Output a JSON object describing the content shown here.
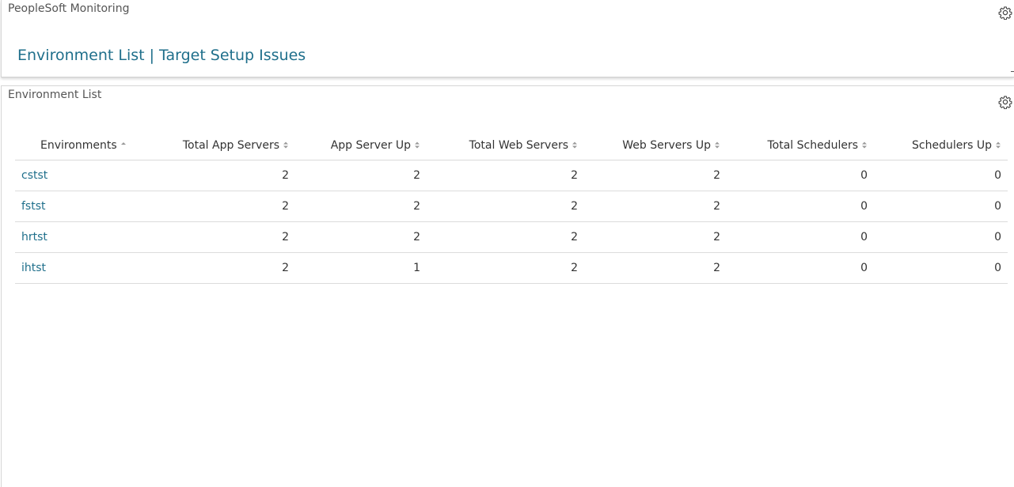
{
  "top_panel": {
    "title": "PeopleSoft Monitoring",
    "links": [
      "Environment List",
      "Target Setup Issues"
    ],
    "separator": "|"
  },
  "bottom_panel": {
    "title": "Environment List",
    "columns": [
      "Environments",
      "Total App Servers",
      "App Server Up",
      "Total Web Servers",
      "Web Servers Up",
      "Total Schedulers",
      "Schedulers Up"
    ],
    "rows": [
      {
        "name": "cstst",
        "total_app": "2",
        "app_up": "2",
        "total_web": "2",
        "web_up": "2",
        "total_sched": "0",
        "sched_up": "0"
      },
      {
        "name": "fstst",
        "total_app": "2",
        "app_up": "2",
        "total_web": "2",
        "web_up": "2",
        "total_sched": "0",
        "sched_up": "0"
      },
      {
        "name": "hrtst",
        "total_app": "2",
        "app_up": "2",
        "total_web": "2",
        "web_up": "2",
        "total_sched": "0",
        "sched_up": "0"
      },
      {
        "name": "ihtst",
        "total_app": "2",
        "app_up": "1",
        "total_web": "2",
        "web_up": "2",
        "total_sched": "0",
        "sched_up": "0"
      }
    ]
  },
  "colors": {
    "link": "#1f6f8b",
    "warning": "#e08a1e"
  },
  "icons": {
    "settings": "gear-icon",
    "sort_ascending": "sort-ascending-icon",
    "sort_both": "sort-icon"
  }
}
